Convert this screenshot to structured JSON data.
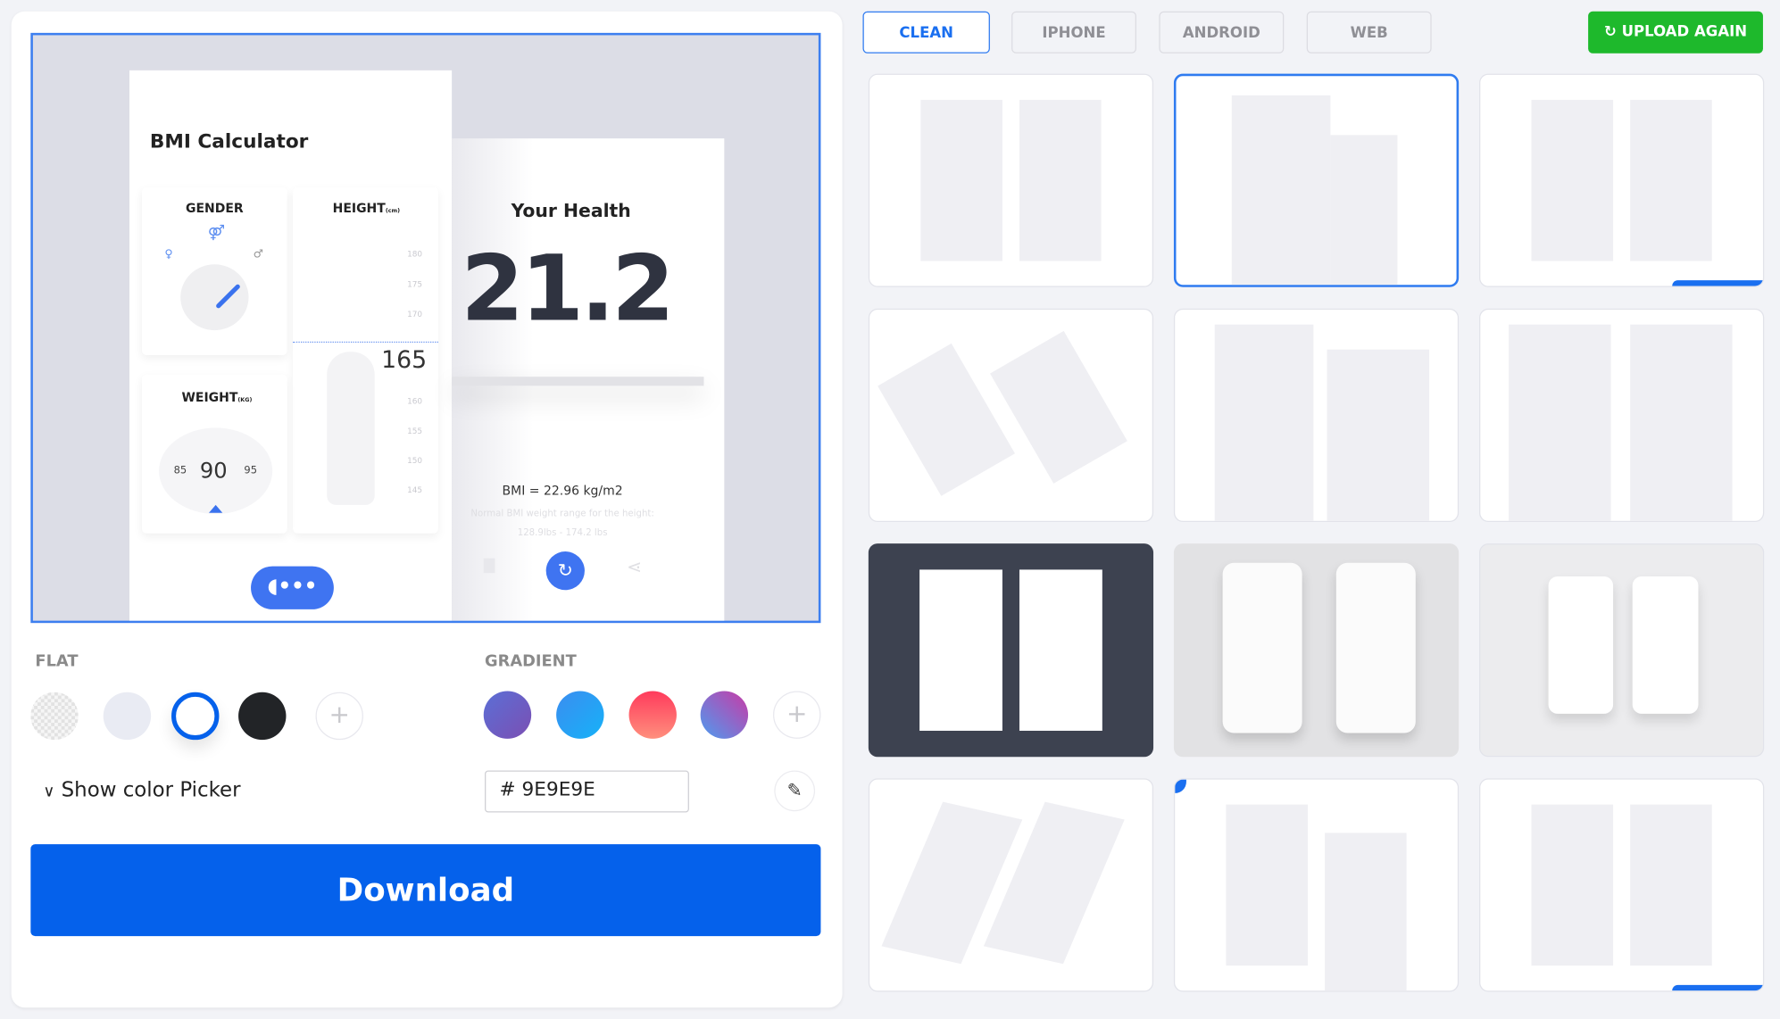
{
  "preview": {
    "app_title": "BMI Calculator",
    "gender_label": "GENDER",
    "height_label": "HEIGHT",
    "height_unit": "(cm)",
    "height_ticks_top": [
      "180",
      "175",
      "170"
    ],
    "height_value": "165",
    "height_ticks_bottom": [
      "160",
      "155",
      "150",
      "145"
    ],
    "weight_label": "WEIGHT",
    "weight_unit": "(KG)",
    "weight_prev": "85",
    "weight_value": "90",
    "weight_next": "95",
    "result_title": "Your Health",
    "bmi_big": "21.2",
    "bmi_formula": "BMI = 22.96 kg/m2",
    "normal_range_label": "Normal BMI weight range for the height:",
    "normal_range_value": "128.9lbs - 174.2 lbs"
  },
  "background": {
    "flat_label": "FLAT",
    "flat_swatches": [
      {
        "name": "transparent",
        "color": "checker"
      },
      {
        "name": "light",
        "color": "#e9ebf3"
      },
      {
        "name": "white",
        "color": "#ffffff",
        "selected": true
      },
      {
        "name": "black",
        "color": "#222427"
      }
    ],
    "gradient_label": "GRADIENT",
    "gradient_swatches": [
      {
        "name": "purple",
        "from": "#5b6fd6",
        "to": "#7b4fb3"
      },
      {
        "name": "blue",
        "from": "#3b8df0",
        "to": "#16b2f8"
      },
      {
        "name": "red",
        "from": "#ff3b5c",
        "to": "#ff8f7d"
      },
      {
        "name": "violet",
        "from": "#c93aa6",
        "to": "#4d9cf0"
      }
    ],
    "add_symbol": "+",
    "show_picker_label": "Show color Picker",
    "hex_prefix": "#",
    "hex_value": "9E9E9E"
  },
  "download_label": "Download",
  "tabs": [
    {
      "label": "CLEAN",
      "active": true
    },
    {
      "label": "IPHONE"
    },
    {
      "label": "ANDROID"
    },
    {
      "label": "WEB"
    }
  ],
  "upload_label": "UPLOAD AGAIN",
  "colors": {
    "accent": "#0561eb",
    "upload": "#1eb92c",
    "selection": "#2f7bf0"
  },
  "templates": [
    {
      "style": "two-screens"
    },
    {
      "style": "staggered-tall",
      "selected": true
    },
    {
      "style": "two-screens-fade"
    },
    {
      "style": "tilted-left"
    },
    {
      "style": "staggered"
    },
    {
      "style": "two-screens-wide"
    },
    {
      "style": "dark-two-screens"
    },
    {
      "style": "android-phones"
    },
    {
      "style": "iphone-phones"
    },
    {
      "style": "tilted-right"
    },
    {
      "style": "staggered-corner"
    },
    {
      "style": "two-screens-fade"
    }
  ]
}
